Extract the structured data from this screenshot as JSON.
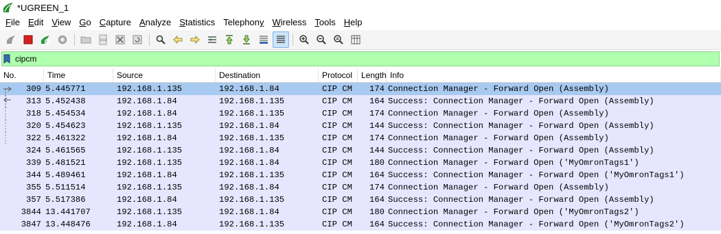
{
  "window": {
    "title": "*UGREEN_1"
  },
  "menu": [
    {
      "label": "File",
      "mnemonic": "F",
      "rest": "ile"
    },
    {
      "label": "Edit",
      "mnemonic": "E",
      "rest": "dit"
    },
    {
      "label": "View",
      "mnemonic": "V",
      "rest": "iew"
    },
    {
      "label": "Go",
      "mnemonic": "G",
      "rest": "o"
    },
    {
      "label": "Capture",
      "mnemonic": "C",
      "rest": "apture"
    },
    {
      "label": "Analyze",
      "mnemonic": "A",
      "rest": "nalyze"
    },
    {
      "label": "Statistics",
      "mnemonic": "S",
      "rest": "tatistics"
    },
    {
      "label": "Telephony",
      "pre": "Telephon",
      "mnemonic": "y",
      "rest": ""
    },
    {
      "label": "Wireless",
      "mnemonic": "W",
      "rest": "ireless"
    },
    {
      "label": "Tools",
      "mnemonic": "T",
      "rest": "ools"
    },
    {
      "label": "Help",
      "mnemonic": "H",
      "rest": "elp"
    }
  ],
  "filter": {
    "value": "cipcm"
  },
  "colors": {
    "row_bg": "#e7e6ff",
    "selected_bg": "#a8c9f0",
    "filter_bg": "#afffaf"
  },
  "columns": [
    "No.",
    "Time",
    "Source",
    "Destination",
    "Protocol",
    "Length",
    "Info"
  ],
  "packets": [
    {
      "no": "309",
      "time": "5.445771",
      "src": "192.168.1.135",
      "dst": "192.168.1.84",
      "proto": "CIP CM",
      "len": "174",
      "info": "Connection Manager - Forward Open (Assembly)",
      "selected": true
    },
    {
      "no": "313",
      "time": "5.452438",
      "src": "192.168.1.84",
      "dst": "192.168.1.135",
      "proto": "CIP CM",
      "len": "164",
      "info": "Success: Connection Manager - Forward Open (Assembly)"
    },
    {
      "no": "318",
      "time": "5.454534",
      "src": "192.168.1.84",
      "dst": "192.168.1.135",
      "proto": "CIP CM",
      "len": "174",
      "info": "Connection Manager - Forward Open (Assembly)"
    },
    {
      "no": "320",
      "time": "5.454623",
      "src": "192.168.1.135",
      "dst": "192.168.1.84",
      "proto": "CIP CM",
      "len": "144",
      "info": "Success: Connection Manager - Forward Open (Assembly)"
    },
    {
      "no": "322",
      "time": "5.461322",
      "src": "192.168.1.84",
      "dst": "192.168.1.135",
      "proto": "CIP CM",
      "len": "174",
      "info": "Connection Manager - Forward Open (Assembly)"
    },
    {
      "no": "324",
      "time": "5.461565",
      "src": "192.168.1.135",
      "dst": "192.168.1.84",
      "proto": "CIP CM",
      "len": "144",
      "info": "Success: Connection Manager - Forward Open (Assembly)"
    },
    {
      "no": "339",
      "time": "5.481521",
      "src": "192.168.1.135",
      "dst": "192.168.1.84",
      "proto": "CIP CM",
      "len": "180",
      "info": "Connection Manager - Forward Open ('MyOmronTags1')"
    },
    {
      "no": "344",
      "time": "5.489461",
      "src": "192.168.1.84",
      "dst": "192.168.1.135",
      "proto": "CIP CM",
      "len": "164",
      "info": "Success: Connection Manager - Forward Open ('MyOmronTags1')"
    },
    {
      "no": "355",
      "time": "5.511514",
      "src": "192.168.1.135",
      "dst": "192.168.1.84",
      "proto": "CIP CM",
      "len": "174",
      "info": "Connection Manager - Forward Open (Assembly)"
    },
    {
      "no": "357",
      "time": "5.517386",
      "src": "192.168.1.84",
      "dst": "192.168.1.135",
      "proto": "CIP CM",
      "len": "164",
      "info": "Success: Connection Manager - Forward Open (Assembly)"
    },
    {
      "no": "3844",
      "time": "13.441707",
      "src": "192.168.1.135",
      "dst": "192.168.1.84",
      "proto": "CIP CM",
      "len": "180",
      "info": "Connection Manager - Forward Open ('MyOmronTags2')"
    },
    {
      "no": "3847",
      "time": "13.448476",
      "src": "192.168.1.84",
      "dst": "192.168.1.135",
      "proto": "CIP CM",
      "len": "164",
      "info": "Success: Connection Manager - Forward Open ('MyOmronTags2')"
    }
  ]
}
